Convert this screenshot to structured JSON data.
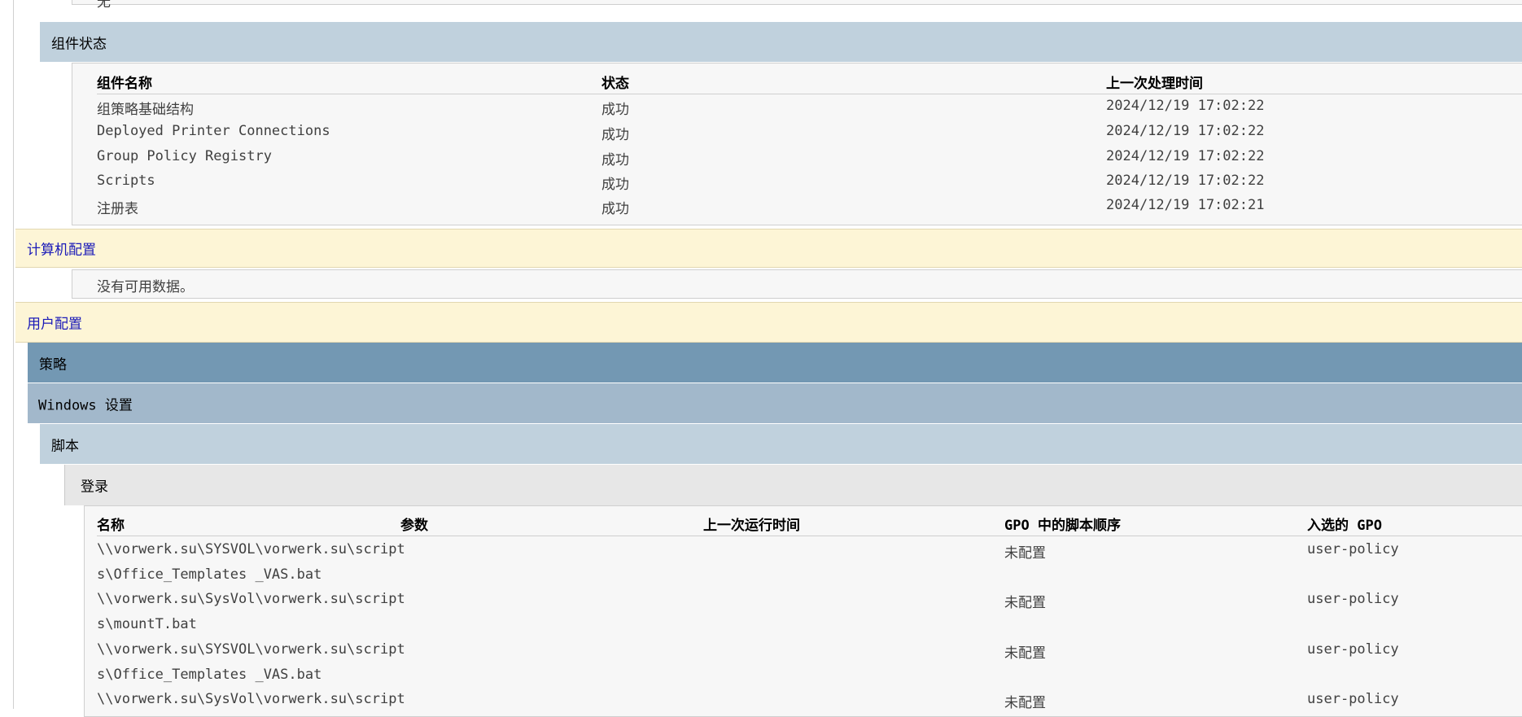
{
  "top_fragment": "无",
  "component_status": {
    "title": "组件状态",
    "headers": [
      "组件名称",
      "状态",
      "上一次处理时间"
    ],
    "rows": [
      [
        "组策略基础结构",
        "成功",
        "2024/12/19 17:02:22"
      ],
      [
        "Deployed Printer Connections",
        "成功",
        "2024/12/19 17:02:22"
      ],
      [
        "Group Policy Registry",
        "成功",
        "2024/12/19 17:02:22"
      ],
      [
        "Scripts",
        "成功",
        "2024/12/19 17:02:22"
      ],
      [
        "注册表",
        "成功",
        "2024/12/19 17:02:21"
      ]
    ]
  },
  "computer_config": {
    "title": "计算机配置",
    "no_data": "没有可用数据。"
  },
  "user_config": {
    "title": "用户配置",
    "policy": "策略",
    "windows_settings": "Windows 设置",
    "scripts": "脚本",
    "logon": "登录",
    "headers": [
      "名称",
      "参数",
      "上一次运行时间",
      "GPO 中的脚本顺序",
      "入选的 GPO"
    ],
    "rows": [
      {
        "name_line1": "\\\\vorwerk.su\\SYSVOL\\vorwerk.su\\script",
        "name_line2": "s\\Office_Templates _VAS.bat",
        "params": "",
        "last_run": "",
        "order": "未配置",
        "gpo": "user-policy"
      },
      {
        "name_line1": "\\\\vorwerk.su\\SysVol\\vorwerk.su\\script",
        "name_line2": "s\\mountT.bat",
        "params": "",
        "last_run": "",
        "order": "未配置",
        "gpo": "user-policy"
      },
      {
        "name_line1": "\\\\vorwerk.su\\SYSVOL\\vorwerk.su\\script",
        "name_line2": "s\\Office_Templates _VAS.bat",
        "params": "",
        "last_run": "",
        "order": "未配置",
        "gpo": "user-policy"
      },
      {
        "name_line1": "\\\\vorwerk.su\\SysVol\\vorwerk.su\\script",
        "name_line2": "",
        "params": "",
        "last_run": "",
        "order": "未配置",
        "gpo": "user-policy"
      }
    ]
  }
}
